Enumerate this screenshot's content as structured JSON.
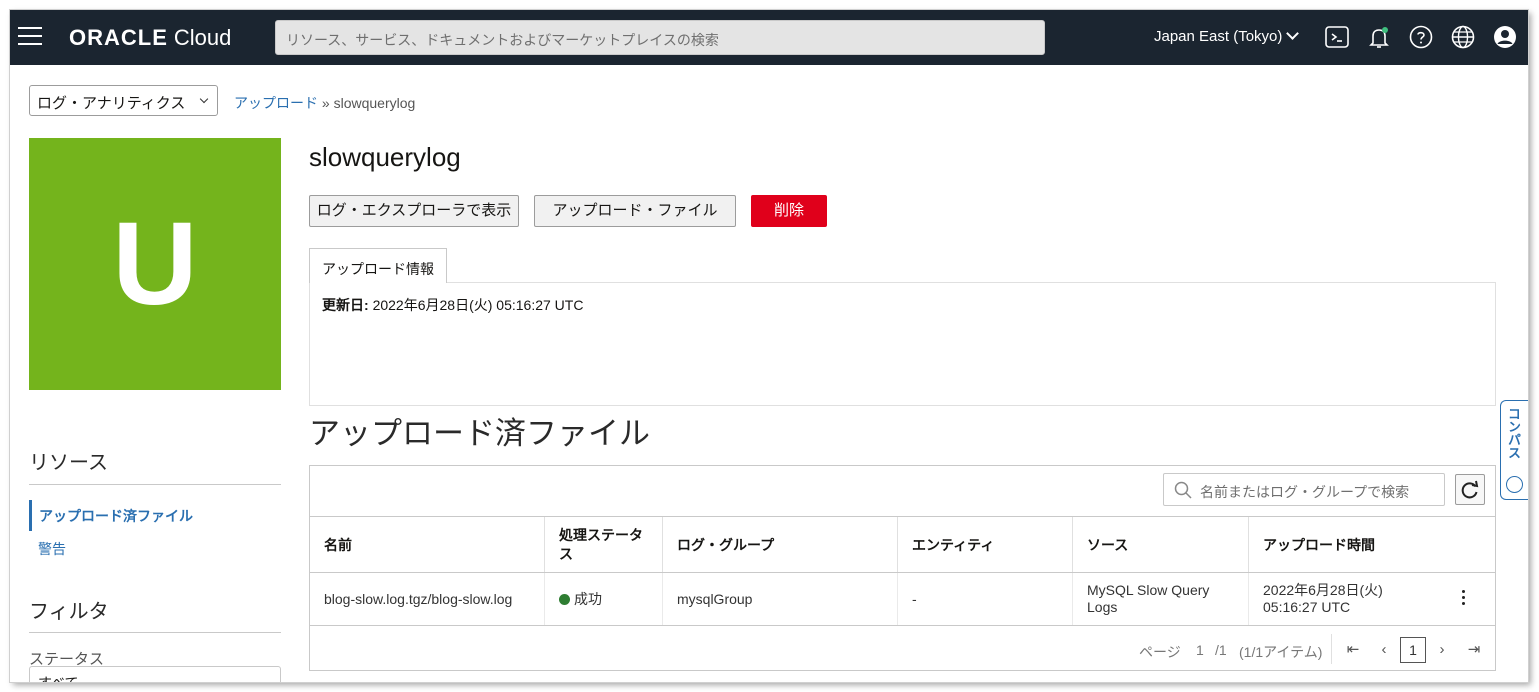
{
  "header": {
    "brand": "ORACLE",
    "brand_suffix": "Cloud",
    "search_placeholder": "リソース、サービス、ドキュメントおよびマーケットプレイスの検索",
    "region": "Japan East (Tokyo)"
  },
  "compartment": {
    "value": "ログ・アナリティクス"
  },
  "breadcrumb": {
    "link": "アップロード",
    "separator": "»",
    "current": "slowquerylog"
  },
  "hero": {
    "letter": "U",
    "color": "#74b41c"
  },
  "sidebar": {
    "resources_title": "リソース",
    "items": [
      {
        "label": "アップロード済ファイル",
        "active": true
      },
      {
        "label": "警告",
        "active": false
      }
    ],
    "filter_title": "フィルタ",
    "status_label": "ステータス",
    "status_value": "すべて"
  },
  "page": {
    "title": "slowquerylog",
    "buttons": {
      "log_explorer": "ログ・エクスプローラで表示",
      "upload_file": "アップロード・ファイル",
      "delete": "削除"
    },
    "tab": "アップロード情報",
    "info": {
      "updated_label": "更新日:",
      "updated_value": "2022年6月28日(火) 05:16:27 UTC"
    },
    "section_title": "アップロード済ファイル"
  },
  "table": {
    "search_placeholder": "名前またはログ・グループで検索",
    "columns": [
      "名前",
      "処理ステータス",
      "ログ・グループ",
      "エンティティ",
      "ソース",
      "アップロード時間"
    ],
    "rows": [
      {
        "name": "blog-slow.log.tgz/blog-slow.log",
        "status": "成功",
        "log_group": "mysqlGroup",
        "entity": "-",
        "source": "MySQL Slow Query Logs",
        "upload_time": "2022年6月28日(火) 05:16:27 UTC"
      }
    ],
    "pagination": {
      "page_label": "ページ",
      "page": "1",
      "of": "/1",
      "items": "(1/1アイテム)",
      "current": "1"
    }
  },
  "compass": {
    "label": "コンパス"
  },
  "colors": {
    "topbar": "#1b2530",
    "danger": "#e0001b",
    "link": "#2a6fb0",
    "success": "#2e7d32"
  }
}
